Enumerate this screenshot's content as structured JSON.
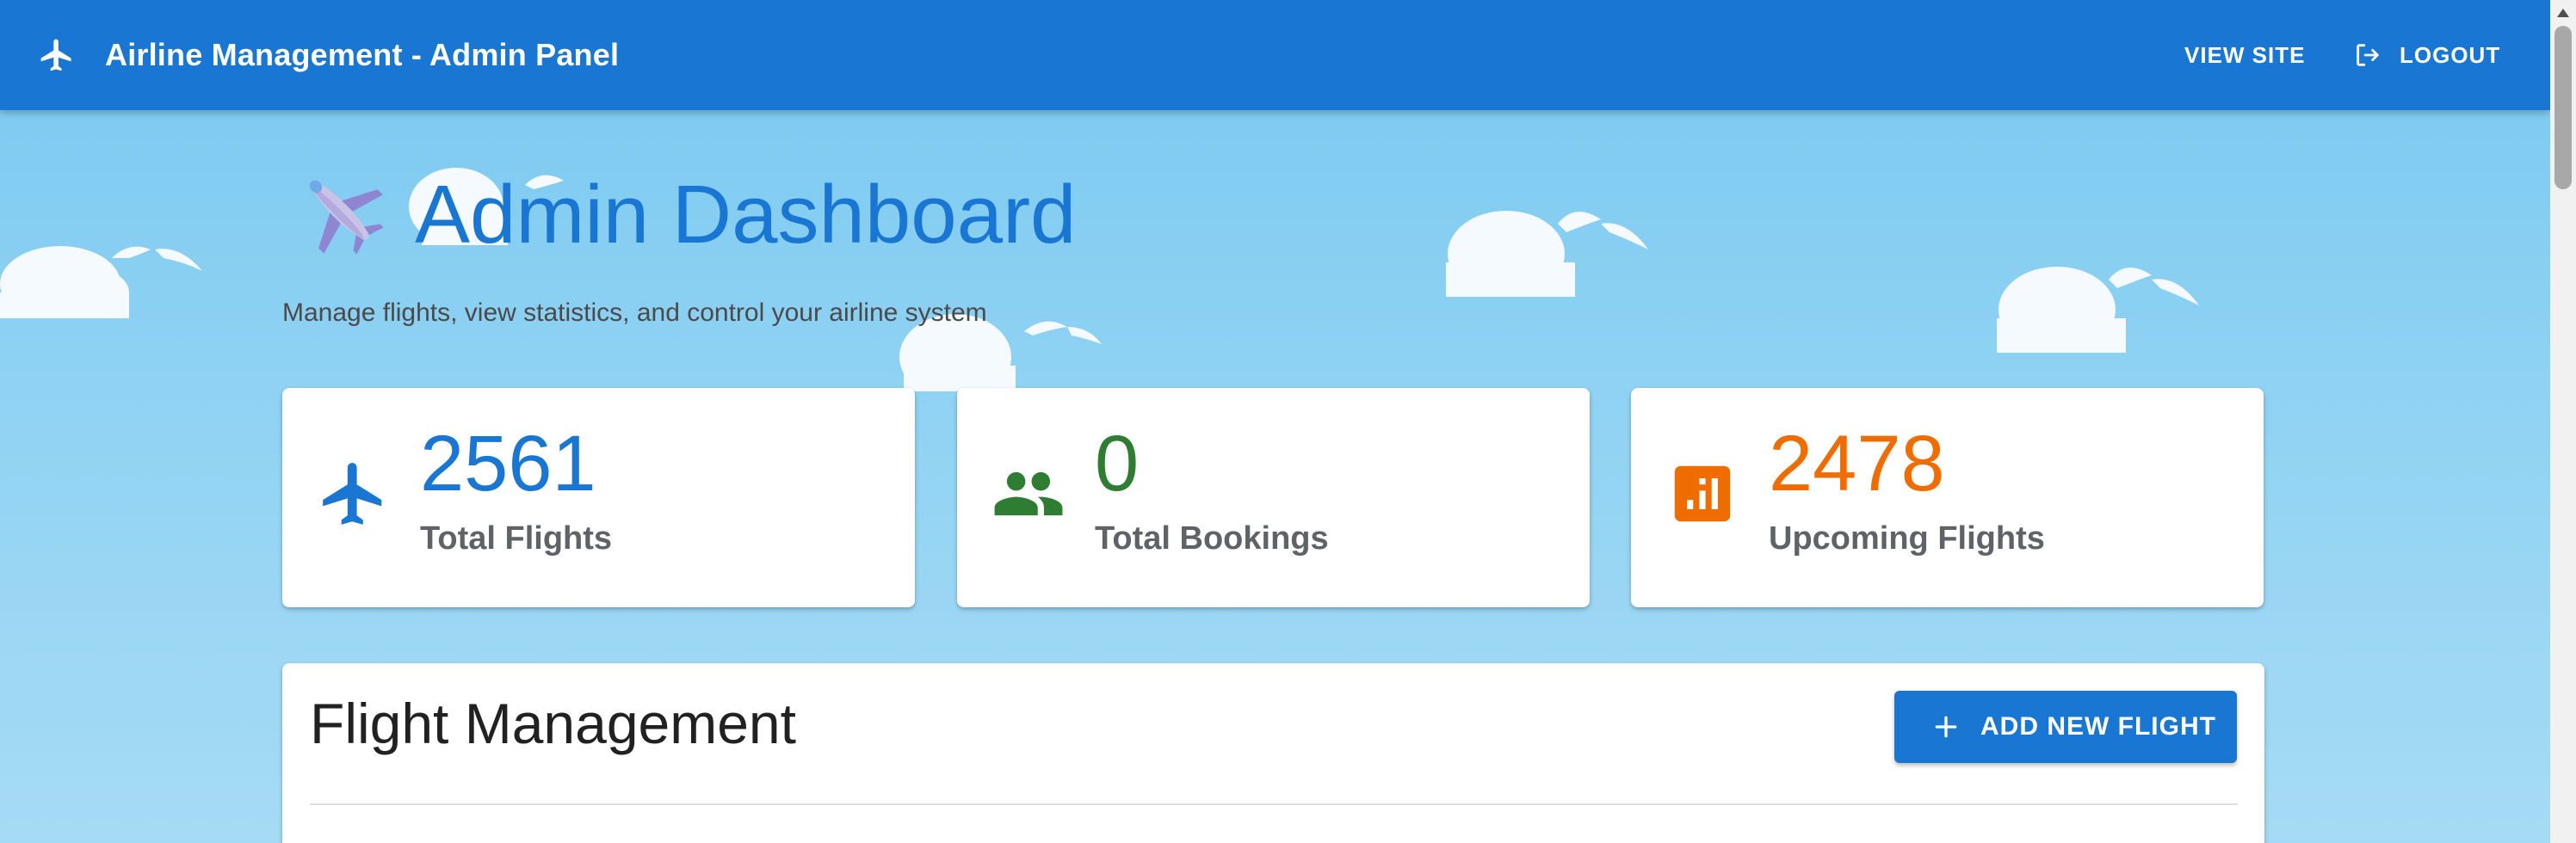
{
  "appbar": {
    "title": "Airline Management - Admin Panel",
    "brand_icon": "airplane-icon",
    "view_site_label": "VIEW SITE",
    "logout_label": "LOGOUT",
    "logout_icon": "logout-icon",
    "background_color": "#1976d2"
  },
  "header": {
    "emoji": "airplane-emoji",
    "title": "Admin Dashboard",
    "subtitle": "Manage flights, view statistics, and control your airline system"
  },
  "stats": [
    {
      "icon": "airplane-icon",
      "value": "2561",
      "label": "Total Flights",
      "color": "#1976d2"
    },
    {
      "icon": "people-icon",
      "value": "0",
      "label": "Total Bookings",
      "color": "#2e7d32"
    },
    {
      "icon": "bar-chart-icon",
      "value": "2478",
      "label": "Upcoming Flights",
      "color": "#ef6c00"
    }
  ],
  "flight_management": {
    "title": "Flight Management",
    "add_button_label": "ADD NEW FLIGHT",
    "add_button_icon": "plus-icon"
  },
  "colors": {
    "primary": "#1976d2",
    "success": "#2e7d32",
    "warning": "#ef6c00",
    "sky": "#86cff2"
  }
}
